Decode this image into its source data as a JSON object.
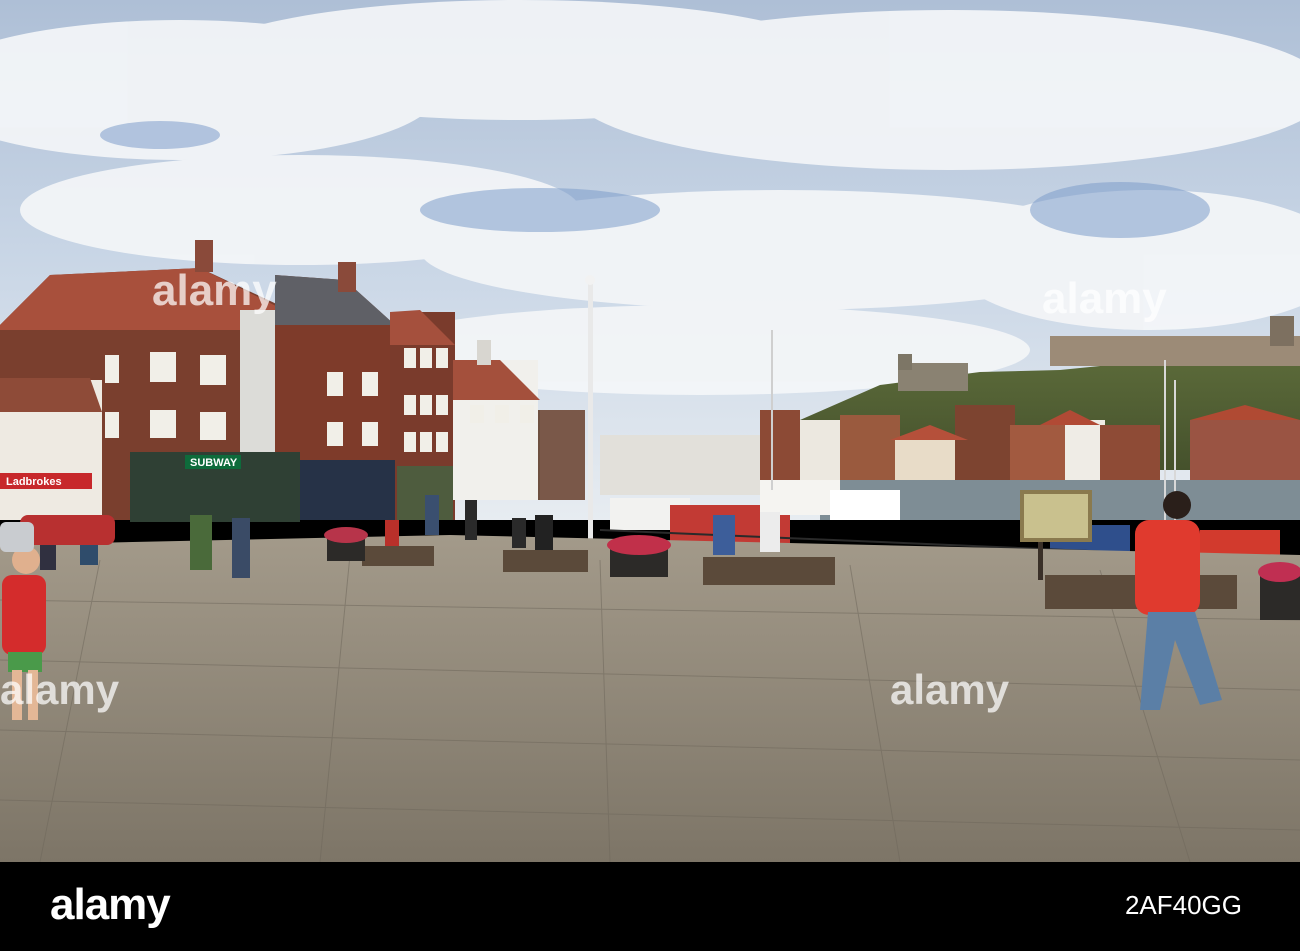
{
  "scene": {
    "description_colors": {
      "sky_top": "#b9cbe0",
      "sky_blue": "#6f94c6",
      "pavement": "#8d8577",
      "brick": "#7a3f2e"
    }
  },
  "shop_signs": {
    "ladbrokes": "Ladbrokes",
    "subway": "SUBWAY"
  },
  "watermarks": {
    "center": "alamy",
    "right": "alamy",
    "left_bottom": "alamy",
    "right_bottom": "alamy"
  },
  "footer": {
    "brand": "alamy",
    "image_id": "2AF40GG"
  }
}
